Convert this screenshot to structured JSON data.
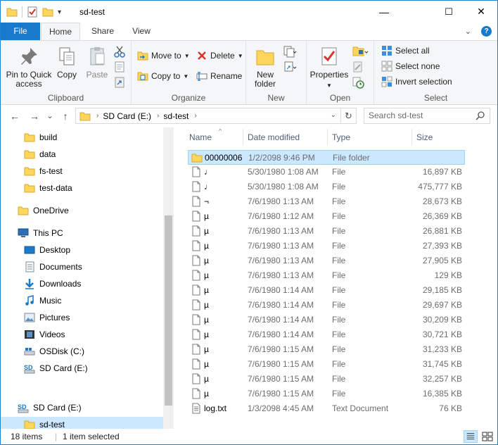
{
  "window": {
    "title": "sd-test",
    "controls": {
      "minimize": "—",
      "maximize": "☐",
      "close": "✕"
    }
  },
  "qat": {
    "dropdown_glyph": "▾"
  },
  "ribbon_tabs": {
    "file": "File",
    "home": "Home",
    "share": "Share",
    "view": "View",
    "collapse_glyph": "⌄",
    "help_glyph": "?"
  },
  "ribbon": {
    "clipboard": {
      "label": "Clipboard",
      "pin_label": "Pin to Quick access",
      "copy_label": "Copy",
      "paste_label": "Paste"
    },
    "organize": {
      "label": "Organize",
      "move_to": "Move to",
      "copy_to": "Copy to",
      "delete": "Delete",
      "rename": "Rename"
    },
    "new": {
      "label": "New",
      "new_folder": "New folder"
    },
    "open": {
      "label": "Open",
      "properties": "Properties"
    },
    "select": {
      "label": "Select",
      "select_all": "Select all",
      "select_none": "Select none",
      "invert_selection": "Invert selection"
    }
  },
  "address": {
    "crumbs": [
      "SD Card (E:)",
      "sd-test"
    ],
    "back": "←",
    "forward": "→",
    "recent": "⌄",
    "up": "↑",
    "dropdown": "⌄",
    "refresh": "↻",
    "search_placeholder": "Search sd-test"
  },
  "nav_pane": {
    "items": [
      {
        "label": "build",
        "icon": "folder-icon"
      },
      {
        "label": "data",
        "icon": "folder-icon"
      },
      {
        "label": "fs-test",
        "icon": "folder-icon"
      },
      {
        "label": "test-data",
        "icon": "folder-icon"
      },
      {
        "label": "OneDrive",
        "icon": "folder-icon"
      },
      {
        "label": "This PC",
        "icon": "computer-icon"
      },
      {
        "label": "Desktop",
        "icon": "desktop-icon"
      },
      {
        "label": "Documents",
        "icon": "documents-icon"
      },
      {
        "label": "Downloads",
        "icon": "downloads-icon"
      },
      {
        "label": "Music",
        "icon": "music-icon"
      },
      {
        "label": "Pictures",
        "icon": "pictures-icon"
      },
      {
        "label": "Videos",
        "icon": "videos-icon"
      },
      {
        "label": "OSDisk (C:)",
        "icon": "drive-icon"
      },
      {
        "label": "SD Card (E:)",
        "icon": "sdcard-icon"
      },
      {
        "label": "SD Card (E:)",
        "icon": "sdcard-icon"
      },
      {
        "label": "sd-test",
        "icon": "folder-icon"
      }
    ]
  },
  "file_list": {
    "columns": {
      "name": "Name",
      "date": "Date modified",
      "type": "Type",
      "size": "Size"
    },
    "sort_caret": "^",
    "rows": [
      {
        "name": "00000006",
        "date": "1/2/2098 9:46 PM",
        "type": "File folder",
        "size": ""
      },
      {
        "name": "♩",
        "date": "5/30/1980 1:08 AM",
        "type": "File",
        "size": "16,897 KB"
      },
      {
        "name": "♩",
        "date": "5/30/1980 1:08 AM",
        "type": "File",
        "size": "475,777 KB"
      },
      {
        "name": "¬",
        "date": "7/6/1980 1:13 AM",
        "type": "File",
        "size": "28,673 KB"
      },
      {
        "name": "µ",
        "date": "7/6/1980 1:12 AM",
        "type": "File",
        "size": "26,369 KB"
      },
      {
        "name": "µ",
        "date": "7/6/1980 1:13 AM",
        "type": "File",
        "size": "26,881 KB"
      },
      {
        "name": "µ",
        "date": "7/6/1980 1:13 AM",
        "type": "File",
        "size": "27,393 KB"
      },
      {
        "name": "µ",
        "date": "7/6/1980 1:13 AM",
        "type": "File",
        "size": "27,905 KB"
      },
      {
        "name": "µ",
        "date": "7/6/1980 1:13 AM",
        "type": "File",
        "size": "129 KB"
      },
      {
        "name": "µ",
        "date": "7/6/1980 1:14 AM",
        "type": "File",
        "size": "29,185 KB"
      },
      {
        "name": "µ",
        "date": "7/6/1980 1:14 AM",
        "type": "File",
        "size": "29,697 KB"
      },
      {
        "name": "µ",
        "date": "7/6/1980 1:14 AM",
        "type": "File",
        "size": "30,209 KB"
      },
      {
        "name": "µ",
        "date": "7/6/1980 1:14 AM",
        "type": "File",
        "size": "30,721 KB"
      },
      {
        "name": "µ",
        "date": "7/6/1980 1:15 AM",
        "type": "File",
        "size": "31,233 KB"
      },
      {
        "name": "µ",
        "date": "7/6/1980 1:15 AM",
        "type": "File",
        "size": "31,745 KB"
      },
      {
        "name": "µ",
        "date": "7/6/1980 1:15 AM",
        "type": "File",
        "size": "32,257 KB"
      },
      {
        "name": "µ",
        "date": "7/6/1980 1:15 AM",
        "type": "File",
        "size": "16,385 KB"
      },
      {
        "name": "log.txt",
        "date": "1/3/2098 4:45 AM",
        "type": "Text Document",
        "size": "76 KB"
      }
    ]
  },
  "status": {
    "item_count": "18 items",
    "selected": "1 item selected"
  },
  "colors": {
    "accent": "#1979ca",
    "selection": "#cce8ff",
    "folder": "#ffd65c",
    "window_border": "#1883d7"
  }
}
